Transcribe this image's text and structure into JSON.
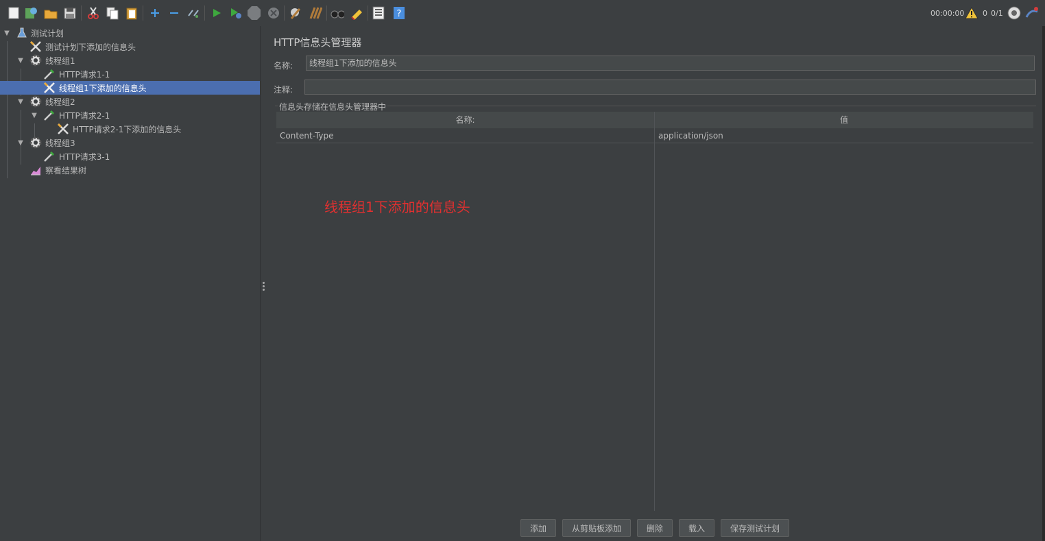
{
  "toolbar": {
    "buttons": [
      {
        "name": "new-icon"
      },
      {
        "name": "templates-icon"
      },
      {
        "name": "open-icon"
      },
      {
        "name": "save-icon"
      },
      {
        "name": "cut-icon"
      },
      {
        "name": "copy-icon"
      },
      {
        "name": "paste-icon"
      },
      {
        "name": "expand-all-icon"
      },
      {
        "name": "collapse-all-icon"
      },
      {
        "name": "toggle-icon"
      },
      {
        "name": "start-icon"
      },
      {
        "name": "start-no-pauses-icon"
      },
      {
        "name": "stop-icon"
      },
      {
        "name": "shutdown-icon"
      },
      {
        "name": "clear-icon"
      },
      {
        "name": "clear-all-icon"
      },
      {
        "name": "search-icon"
      },
      {
        "name": "reset-search-icon"
      },
      {
        "name": "function-helper-icon"
      },
      {
        "name": "help-icon"
      }
    ],
    "status": {
      "elapsed": "00:00:00",
      "warnings": "0",
      "threads": "0/1"
    }
  },
  "tree": {
    "items": [
      {
        "label": "测试计划",
        "icon": "test-plan-icon",
        "expanded": true
      },
      {
        "label": "测试计划下添加的信息头",
        "icon": "config-wrench-icon"
      },
      {
        "label": "线程组1",
        "icon": "gear-icon",
        "expanded": true
      },
      {
        "label": "HTTP请求1-1",
        "icon": "sampler-pipette-icon"
      },
      {
        "label": "线程组1下添加的信息头",
        "icon": "config-wrench-icon",
        "selected": true
      },
      {
        "label": "线程组2",
        "icon": "gear-icon",
        "expanded": true
      },
      {
        "label": "HTTP请求2-1",
        "icon": "sampler-pipette-icon",
        "expanded": true
      },
      {
        "label": "HTTP请求2-1下添加的信息头",
        "icon": "config-wrench-icon"
      },
      {
        "label": "线程组3",
        "icon": "gear-icon",
        "expanded": true
      },
      {
        "label": "HTTP请求3-1",
        "icon": "sampler-pipette-icon"
      },
      {
        "label": "察看结果树",
        "icon": "listener-chart-icon"
      }
    ]
  },
  "panel": {
    "title": "HTTP信息头管理器",
    "name_label": "名称:",
    "name_value": "线程组1下添加的信息头",
    "comment_label": "注释:",
    "comment_value": "",
    "group_title": "信息头存储在信息头管理器中",
    "table": {
      "columns": [
        "名称:",
        "值"
      ],
      "rows": [
        {
          "name": "Content-Type",
          "value": "application/json"
        }
      ]
    },
    "annotation": "线程组1下添加的信息头",
    "annotation_color": "#e03030",
    "buttons": {
      "add": "添加",
      "add_from_clipboard": "从剪贴板添加",
      "delete": "删除",
      "load": "载入",
      "save_test_plan": "保存测试计划"
    }
  },
  "colors": {
    "background": "#3c3f41",
    "selection": "#4b6eaf"
  }
}
